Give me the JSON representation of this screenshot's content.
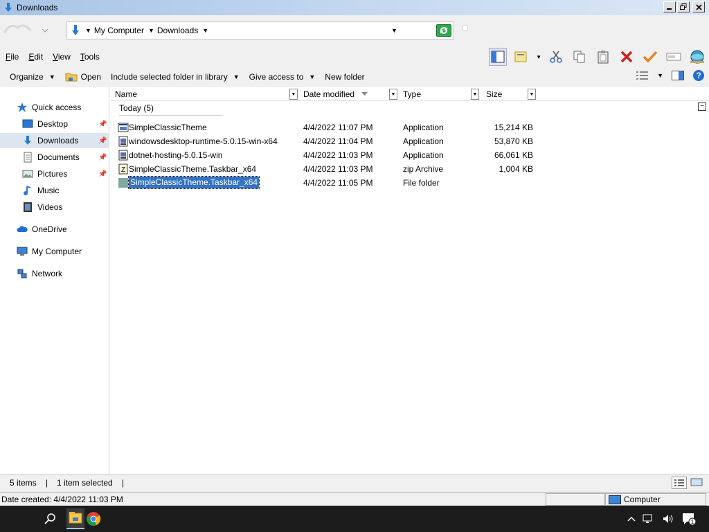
{
  "window": {
    "title": "Downloads"
  },
  "address": {
    "crumbs": [
      "My Computer",
      "Downloads"
    ]
  },
  "menu": {
    "items": [
      {
        "label": "File",
        "u": "F",
        "rest": "ile"
      },
      {
        "label": "Edit",
        "u": "E",
        "rest": "dit"
      },
      {
        "label": "View",
        "u": "V",
        "rest": "iew"
      },
      {
        "label": "Tools",
        "u": "T",
        "rest": "ools"
      }
    ]
  },
  "commands": {
    "organize": "Organize",
    "open": "Open",
    "include": "Include selected folder in library",
    "give_access": "Give access to",
    "new_folder": "New folder"
  },
  "nav": {
    "quick_access": "Quick access",
    "desktop": "Desktop",
    "downloads": "Downloads",
    "documents": "Documents",
    "pictures": "Pictures",
    "music": "Music",
    "videos": "Videos",
    "onedrive": "OneDrive",
    "my_computer": "My Computer",
    "network": "Network"
  },
  "columns": {
    "name": "Name",
    "date": "Date modified",
    "type": "Type",
    "size": "Size"
  },
  "group": {
    "label": "Today (5)"
  },
  "files": [
    {
      "name": "SimpleClassicTheme",
      "date": "4/4/2022 11:07 PM",
      "type": "Application",
      "size": "15,214 KB",
      "icon": "app-icon"
    },
    {
      "name": "windowsdesktop-runtime-5.0.15-win-x64",
      "date": "4/4/2022 11:04 PM",
      "type": "Application",
      "size": "53,870 KB",
      "icon": "installer-icon"
    },
    {
      "name": "dotnet-hosting-5.0.15-win",
      "date": "4/4/2022 11:03 PM",
      "type": "Application",
      "size": "66,061 KB",
      "icon": "installer-icon"
    },
    {
      "name": "SimpleClassicTheme.Taskbar_x64",
      "date": "4/4/2022 11:03 PM",
      "type": "zip Archive",
      "size": "1,004 KB",
      "icon": "zip-icon"
    },
    {
      "name": "SimpleClassicTheme.Taskbar_x64",
      "date": "4/4/2022 11:05 PM",
      "type": "File folder",
      "size": "",
      "icon": "folder-icon"
    }
  ],
  "status": {
    "count": "5 items",
    "selected": "1 item selected"
  },
  "info": {
    "date_created": "Date created: 4/4/2022 11:03 PM",
    "location": "Computer"
  },
  "colors": {
    "selection": "#3472c2",
    "title_gradient_start": "#a8c4e6",
    "taskbar": "#1c1c1c"
  }
}
